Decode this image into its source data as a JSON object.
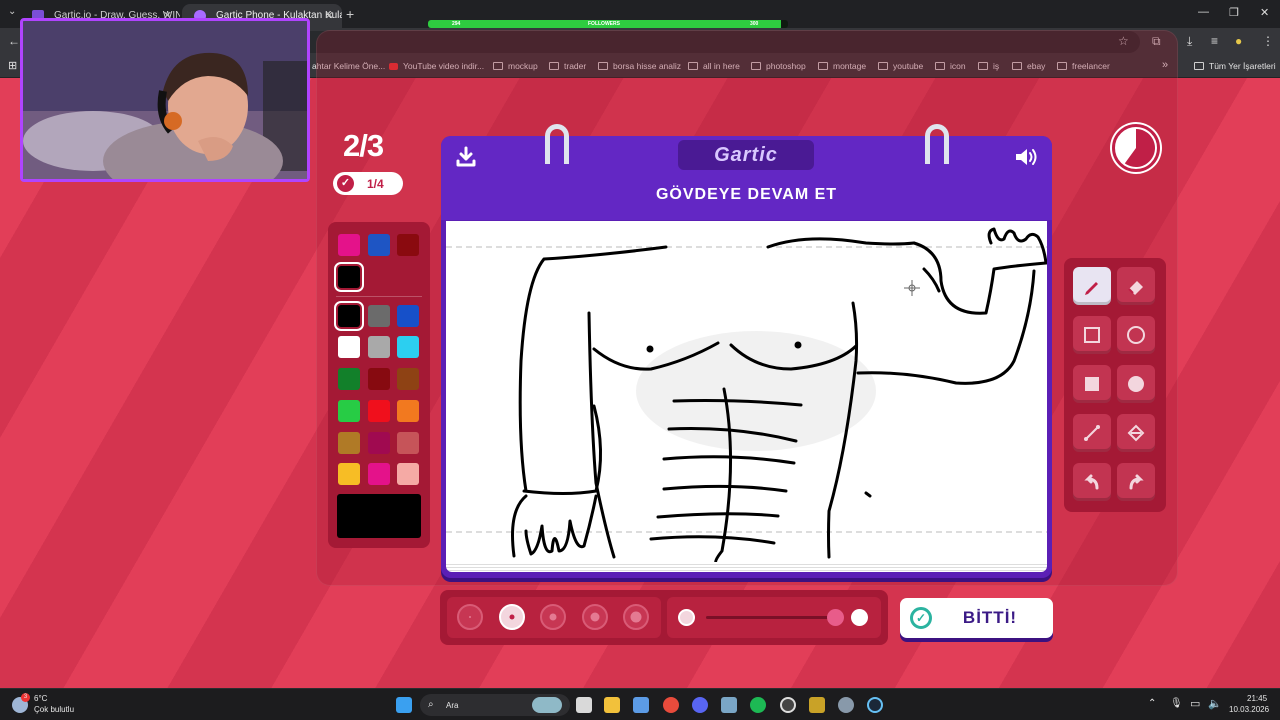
{
  "browser": {
    "tabs": [
      {
        "label": "Gartic.io - Draw, Guess, WIN",
        "close": "✕"
      },
      {
        "label": "Gartic Phone - Kulaktan Kulağa",
        "close": "✕"
      }
    ],
    "new_tab": "+",
    "window_controls": [
      "—",
      "❐",
      "✕"
    ],
    "follow_widget": {
      "current": "294",
      "label": "FOLLOWERS",
      "goal": "300",
      "progress": 0.98
    },
    "bookmarks": [
      "ahtar Kelime Öne...",
      "YouTube video indir...",
      "mockup",
      "trader",
      "borsa hisse analiz",
      "all in here",
      "photoshop",
      "montage",
      "youtube",
      "icon",
      "iş",
      "ebay",
      "freelancer"
    ],
    "bookmarks_more": "»",
    "all_bookmarks": "Tüm Yer İşaretleri"
  },
  "game": {
    "round": "2/3",
    "votes": "1/4",
    "logo": "Gartic",
    "prompt": "GÖVDEYE DEVAM ET",
    "done_button": "BİTTİ!",
    "timer_remaining": 0.6,
    "palette_colors": [
      "#e4128a",
      "#1e55c4",
      "#8a0a0f",
      "#000000",
      "#000000",
      "#6b6b6b",
      "#1650c9",
      "#ffffff",
      "#a9a9a9",
      "#2ccff0",
      "#12802a",
      "#870a10",
      "#8e4214",
      "#27cc45",
      "#f00f1c",
      "#f2791f",
      "#b07a26",
      "#a00a50",
      "#c65459",
      "#f7bd25",
      "#e4128a",
      "#f5aaa5"
    ],
    "current_color": "#000000",
    "tools": [
      {
        "name": "pencil",
        "active": true
      },
      {
        "name": "eraser",
        "active": false
      },
      {
        "name": "rectangle",
        "active": false
      },
      {
        "name": "ellipse",
        "active": false
      },
      {
        "name": "filled-rectangle",
        "active": false
      },
      {
        "name": "filled-ellipse",
        "active": false
      },
      {
        "name": "line",
        "active": false
      },
      {
        "name": "fill-bucket",
        "active": false
      },
      {
        "name": "undo",
        "active": false
      },
      {
        "name": "redo",
        "active": false
      }
    ],
    "brush_sizes_selected": 2,
    "opacity_level": 1.0
  },
  "taskbar": {
    "weather_temp": "6°C",
    "weather_desc": "Çok bulutlu",
    "weather_badge": "3",
    "search_label": "Ara",
    "time": "21:45",
    "date": "10.03.2026"
  }
}
